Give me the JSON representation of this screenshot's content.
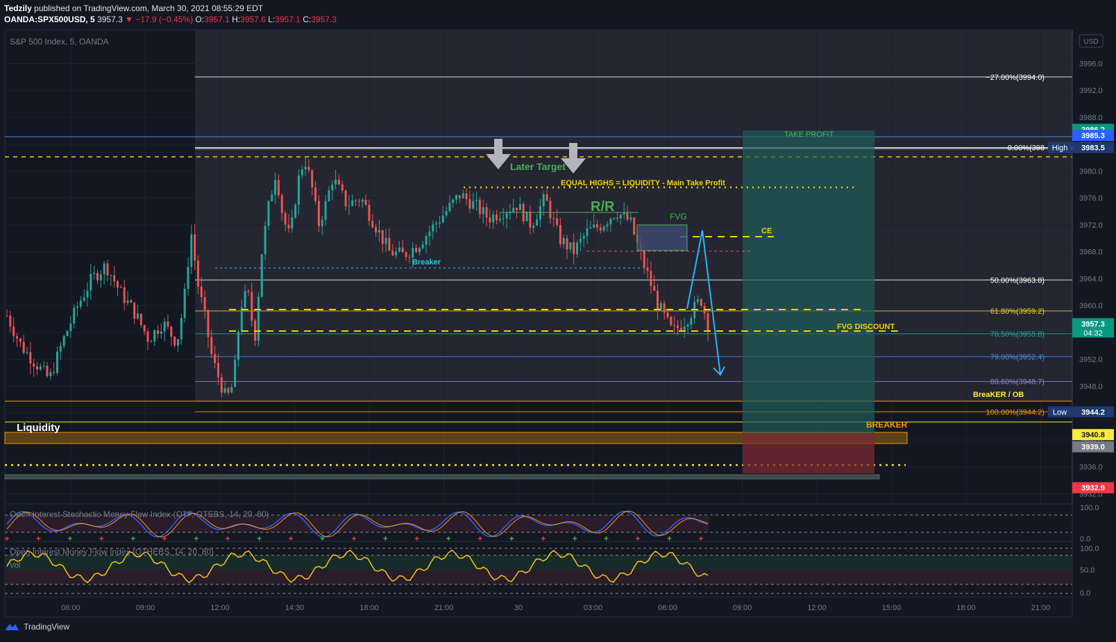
{
  "header": {
    "author": "Tedzily",
    "published_text": "published on TradingView.com, March 30, 2021 08:55:29 EDT",
    "symbol": "OANDA:SPX500USD, 5",
    "last": "3957.3",
    "change": "−17.9 (−0.45%)",
    "o_label": "O:",
    "o_value": "3957.1",
    "h_label": "H:",
    "h_value": "3957.6",
    "l_label": "L:",
    "l_value": "3957.1",
    "c_label": "C:",
    "c_value": "3957.3"
  },
  "pane_title": "S&P 500 Index, 5, OANDA",
  "currency_button": "USD",
  "annotations": {
    "later_target": "Later Target",
    "equal_highs": "EQUAL HIGHS = LIQUIDITY - Main Take Profit",
    "rr": "R/R",
    "fvg": "FVG",
    "ce": "CE",
    "breaker_small": "Breaker",
    "fvg_discount": "FVG DISCOUNT",
    "take_profit": "TAKE PROFIT",
    "breaker_ob": "BreaKER / OB",
    "breaker_big": "BREAKER",
    "liquidity": "Liquidity"
  },
  "fib_levels": [
    {
      "label": "−27.00%(3994.0)",
      "color": "#ffffff"
    },
    {
      "label": "0.00%(398",
      "color": "#ffffff"
    },
    {
      "label": "50.00%(3963.8)",
      "color": "#ffffff"
    },
    {
      "label": "61.80%(3959.2)",
      "color": "#f5d300"
    },
    {
      "label": "70.50%(3955.8)",
      "color": "#26a69a"
    },
    {
      "label": "79.00%(3952.4)",
      "color": "#4f87e0"
    },
    {
      "label": "88.60%(3948.7)",
      "color": "#9c7ccc"
    },
    {
      "label": "100.00%(3944.2)",
      "color": "#ff9800"
    }
  ],
  "price_badges": [
    {
      "text": "3986.2",
      "bg": "#089981",
      "fg": "#ffffff"
    },
    {
      "text": "3985.3",
      "bg": "#2962ff",
      "fg": "#ffffff"
    },
    {
      "text": "3983.5",
      "bg": "#1e3a6e",
      "fg": "#ffffff",
      "tag": "High"
    },
    {
      "text": "3957.3",
      "bg": "#089981",
      "fg": "#ffffff",
      "sub": "04:32"
    },
    {
      "text": "3944.2",
      "bg": "#1e3a6e",
      "fg": "#ffffff",
      "tag": "Low"
    },
    {
      "text": "3940.8",
      "bg": "#ffeb3b",
      "fg": "#131722"
    },
    {
      "text": "3939.0",
      "bg": "#787b86",
      "fg": "#ffffff"
    },
    {
      "text": "3932.9",
      "bg": "#f23645",
      "fg": "#ffffff"
    }
  ],
  "indicators": {
    "ind1_title": "Open Interest Stochastic Money Flow Index (OTF, OTEBS, 14, 20, 80)",
    "ind2_title": "Open Interest Money Flow Index (OTHEBS, 14, 20, 80)",
    "vol_label": "Vol",
    "ind1_axis": [
      "100.0",
      "0.0"
    ],
    "ind2_axis": [
      "100.0",
      "50.0",
      "0.0"
    ]
  },
  "footer": {
    "brand": "TradingView"
  },
  "colors": {
    "bg": "#131722",
    "up": "#26a69a",
    "down": "#ef5350",
    "grid": "#2a2e39"
  },
  "chart_data": {
    "type": "candlestick",
    "symbol": "OANDA:SPX500USD",
    "timeframe": "5",
    "price_axis": [
      "3996.0",
      "3992.0",
      "3988.0",
      "3984.0",
      "3980.0",
      "3976.0",
      "3972.0",
      "3968.0",
      "3964.0",
      "3960.0",
      "3956.0",
      "3952.0",
      "3948.0",
      "3944.0",
      "3940.0",
      "3936.0",
      "3932.0"
    ],
    "ylim": [
      3930.5,
      4001.0
    ],
    "time_axis": [
      "06:00",
      "09:00",
      "12:00",
      "14:30",
      "18:00",
      "21:00",
      "30",
      "03:00",
      "06:00",
      "09:00",
      "12:00",
      "15:00",
      "18:00",
      "21:00"
    ],
    "price_path": [
      [
        0,
        3958.5
      ],
      [
        2,
        3954.0
      ],
      [
        4,
        3951.5
      ],
      [
        6,
        3949.0
      ],
      [
        8,
        3955.0
      ],
      [
        10,
        3960.0
      ],
      [
        12,
        3964.0
      ],
      [
        14,
        3966.0
      ],
      [
        16,
        3962.0
      ],
      [
        18,
        3959.0
      ],
      [
        20,
        3955.0
      ],
      [
        22,
        3957.5
      ],
      [
        24,
        3954.5
      ],
      [
        25,
        3960.5
      ],
      [
        26,
        3971.0
      ],
      [
        27,
        3963.0
      ],
      [
        28,
        3958.0
      ],
      [
        29,
        3952.0
      ],
      [
        31,
        3946.0
      ],
      [
        32,
        3948.5
      ],
      [
        33,
        3960.0
      ],
      [
        34,
        3962.0
      ],
      [
        35,
        3955.0
      ],
      [
        36,
        3968.0
      ],
      [
        37,
        3975.0
      ],
      [
        38,
        3980.0
      ],
      [
        39,
        3973.0
      ],
      [
        40,
        3970.0
      ],
      [
        41,
        3978.0
      ],
      [
        42,
        3982.0
      ],
      [
        43,
        3978.0
      ],
      [
        44,
        3972.0
      ],
      [
        45,
        3975.0
      ],
      [
        46,
        3979.0
      ],
      [
        47,
        3977.0
      ],
      [
        48,
        3975.0
      ],
      [
        50,
        3976.0
      ],
      [
        52,
        3972.0
      ],
      [
        54,
        3968.0
      ],
      [
        56,
        3967.5
      ],
      [
        58,
        3969.0
      ],
      [
        60,
        3971.5
      ],
      [
        62,
        3974.0
      ],
      [
        64,
        3976.5
      ],
      [
        66,
        3975.0
      ],
      [
        68,
        3973.0
      ],
      [
        70,
        3974.0
      ],
      [
        72,
        3975.0
      ],
      [
        74,
        3972.0
      ],
      [
        76,
        3976.0
      ],
      [
        78,
        3970.0
      ],
      [
        80,
        3968.0
      ],
      [
        82,
        3971.0
      ],
      [
        84,
        3972.0
      ],
      [
        86,
        3974.0
      ],
      [
        88,
        3972.5
      ],
      [
        90,
        3966.0
      ],
      [
        92,
        3960.0
      ],
      [
        94,
        3956.0
      ],
      [
        96,
        3958.0
      ],
      [
        98,
        3961.0
      ],
      [
        99,
        3957.3
      ]
    ]
  }
}
